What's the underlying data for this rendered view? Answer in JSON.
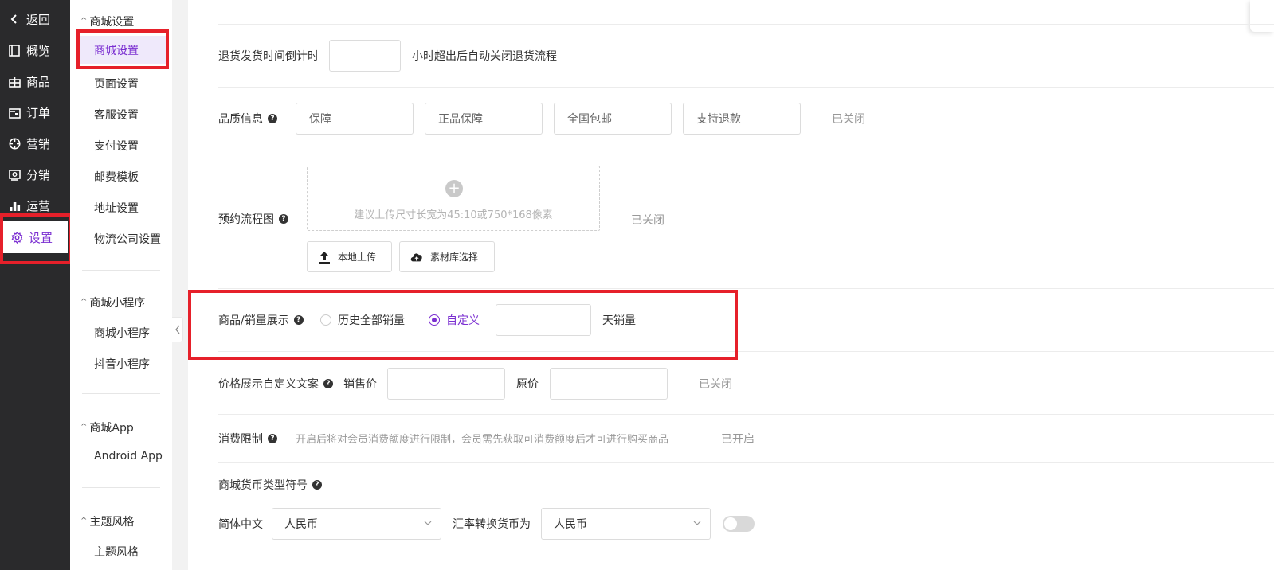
{
  "nav": {
    "back": "返回",
    "items": [
      {
        "label": "概览",
        "icon": "book-icon"
      },
      {
        "label": "商品",
        "icon": "gift-icon"
      },
      {
        "label": "订单",
        "icon": "order-icon"
      },
      {
        "label": "营销",
        "icon": "target-icon"
      },
      {
        "label": "分销",
        "icon": "distribution-icon"
      },
      {
        "label": "运营",
        "icon": "bar-chart-icon"
      },
      {
        "label": "设置",
        "icon": "gear-icon",
        "active": true
      }
    ]
  },
  "sidebar": {
    "groups": [
      {
        "title": "商城设置",
        "items": [
          "商城设置",
          "页面设置",
          "客服设置",
          "支付设置",
          "邮费模板",
          "地址设置",
          "物流公司设置"
        ]
      },
      {
        "title": "商城小程序",
        "items": [
          "商城小程序",
          "抖音小程序"
        ]
      },
      {
        "title": "商城App",
        "items": [
          "Android App"
        ]
      },
      {
        "title": "主题风格",
        "items": [
          "主题风格"
        ]
      }
    ],
    "active_item": "商城设置"
  },
  "form": {
    "return_timeout": {
      "label": "退货发货时间倒计时",
      "value": "",
      "suffix": "小时超出后自动关闭退货流程"
    },
    "quality": {
      "label": "品质信息",
      "placeholders": [
        "保障",
        "正品保障",
        "全国包邮",
        "支持退款"
      ],
      "status": "已关闭"
    },
    "booking_flow": {
      "label": "预约流程图",
      "hint": "建议上传尺寸长宽为45:10或750*168像素",
      "status": "已关闭",
      "local_upload": "本地上传",
      "library_select": "素材库选择"
    },
    "sales_display": {
      "label": "商品/销量展示",
      "option_all": "历史全部销量",
      "option_custom": "自定义",
      "selected": "自定义",
      "days_value": "",
      "suffix": "天销量"
    },
    "price_text": {
      "label": "价格展示自定义文案",
      "sale_label": "销售价",
      "original_label": "原价",
      "sale_value": "",
      "original_value": "",
      "status": "已关闭"
    },
    "consume_limit": {
      "label": "消费限制",
      "desc": "开启后将对会员消费额度进行限制，会员需先获取可消费额度后才可进行购买商品",
      "status": "已开启"
    },
    "currency": {
      "label": "商城货币类型符号",
      "lang_label": "简体中文",
      "lang_value": "人民币",
      "convert_label": "汇率转换货币为",
      "convert_value": "人民币",
      "toggle_on": false
    }
  },
  "colors": {
    "accent": "#7b2fd1",
    "highlight": "#e6202a",
    "nav_bg": "#2a2a2c"
  }
}
